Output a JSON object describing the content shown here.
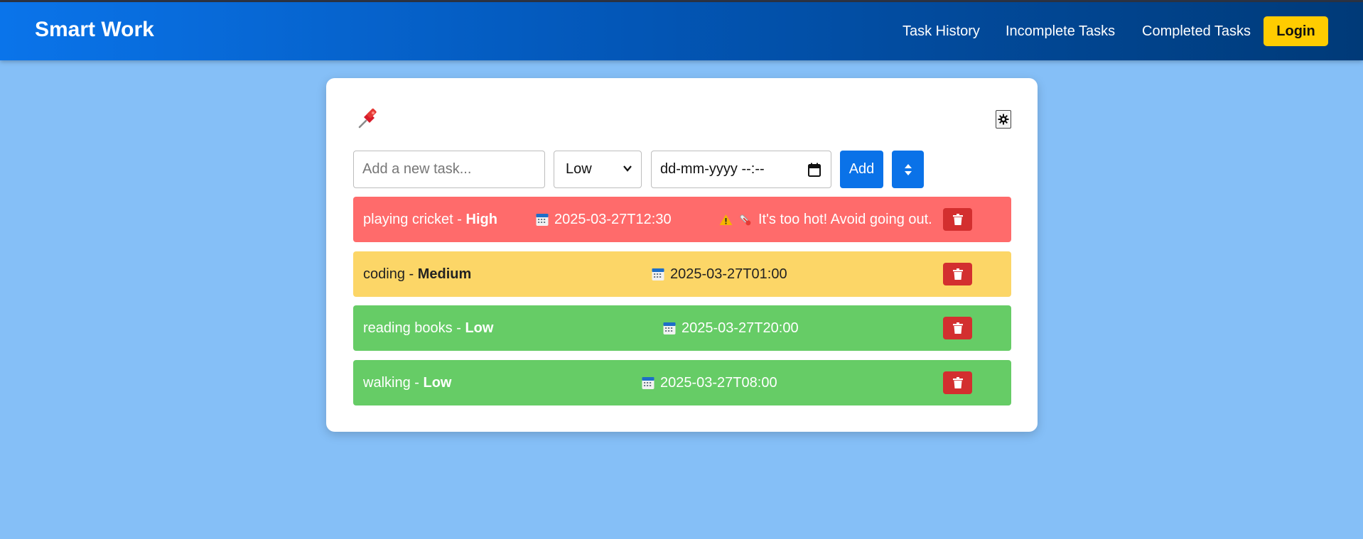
{
  "navbar": {
    "brand": "Smart Work",
    "links": [
      "Task History",
      "Incomplete Tasks",
      "Completed Tasks"
    ],
    "login_label": "Login",
    "gradient": [
      "#0a74ea",
      "#003a78"
    ]
  },
  "form": {
    "task_placeholder": "Add a new task...",
    "priority_selected": "Low",
    "date_placeholder": "dd-mm-yyyy --:--",
    "add_label": "Add"
  },
  "colors": {
    "page_bg": "#85bff7",
    "high": "#ff6b6b",
    "medium": "#fcd667",
    "low": "#66cc66",
    "delete": "#d32f2f",
    "primary": "#0a72e8",
    "login": "#ffcc00"
  },
  "tasks": [
    {
      "name": "playing cricket",
      "separator": " - ",
      "priority": "High",
      "date": "2025-03-27T12:30",
      "warning": "It's too hot! Avoid going out."
    },
    {
      "name": "coding",
      "separator": " - ",
      "priority": "Medium",
      "date": "2025-03-27T01:00"
    },
    {
      "name": "reading books",
      "separator": " - ",
      "priority": "Low",
      "date": "2025-03-27T20:00"
    },
    {
      "name": "walking",
      "separator": " - ",
      "priority": "Low",
      "date": "2025-03-27T08:00"
    }
  ],
  "icons": {
    "pin": "pushpin-icon",
    "theme": "gear-icon",
    "sort": "sort-icon",
    "calendar": "calendar-icon",
    "warning": "warning-icon",
    "thermometer": "thermometer-icon",
    "delete": "trash-icon"
  }
}
